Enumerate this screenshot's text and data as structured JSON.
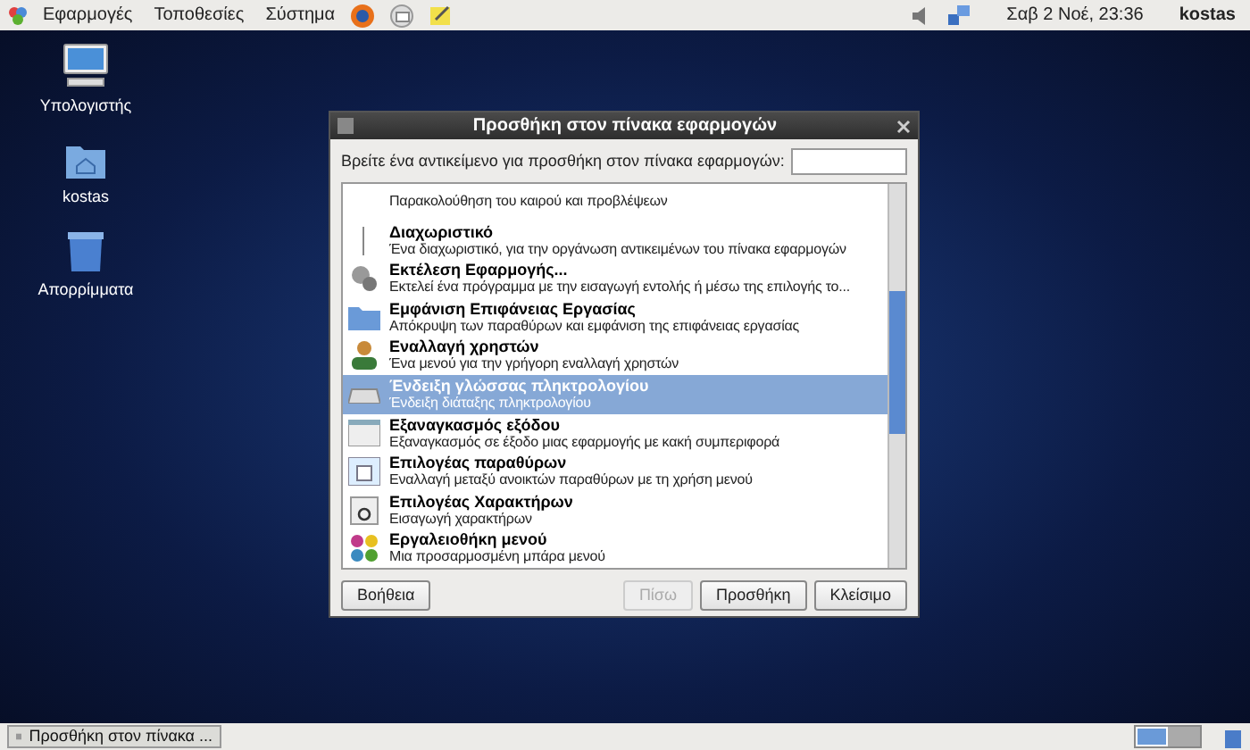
{
  "top_panel": {
    "menus": [
      {
        "label": "Εφαρμογές"
      },
      {
        "label": "Τοποθεσίες"
      },
      {
        "label": "Σύστημα"
      }
    ],
    "clock": "Σαβ  2 Νοέ, 23:36",
    "user": "kostas"
  },
  "desktop_icons": [
    {
      "label": "Υπολογιστής"
    },
    {
      "label": "kostas"
    },
    {
      "label": "Απορρίμματα"
    }
  ],
  "dialog": {
    "title": "Προσθήκη στον πίνακα εφαρμογών",
    "search_label": "Βρείτε ένα αντικείμενο για προσθήκη στον πίνακα εφαρμογών:",
    "items": [
      {
        "description": "Παρακολούθηση του καιρού και προβλέψεων",
        "selected": false
      },
      {
        "title": "Διαχωριστικό",
        "description": "Ένα διαχωριστικό, για την οργάνωση αντικειμένων του πίνακα εφαρμογών",
        "selected": false
      },
      {
        "title": "Εκτέλεση Εφαρμογής...",
        "description": "Εκτελεί ένα πρόγραμμα με την εισαγωγή εντολής ή μέσω της επιλογής το...",
        "selected": false
      },
      {
        "title": "Εμφάνιση Επιφάνειας Εργασίας",
        "description": "Απόκρυψη των παραθύρων και εμφάνιση της επιφάνειας εργασίας",
        "selected": false
      },
      {
        "title": "Εναλλαγή χρηστών",
        "description": "Ένα μενού για την γρήγορη εναλλαγή χρηστών",
        "selected": false
      },
      {
        "title": "Ένδειξη γλώσσας πληκτρολογίου",
        "description": "Ένδειξη διάταξης πληκτρολογίου",
        "selected": true
      },
      {
        "title": "Εξαναγκασμός εξόδου",
        "description": "Εξαναγκασμός σε έξοδο μιας εφαρμογής με κακή συμπεριφορά",
        "selected": false
      },
      {
        "title": "Επιλογέας παραθύρων",
        "description": "Εναλλαγή μεταξύ ανοικτών παραθύρων με τη χρήση μενού",
        "selected": false
      },
      {
        "title": "Επιλογέας Χαρακτήρων",
        "description": "Εισαγωγή χαρακτήρων",
        "selected": false
      },
      {
        "title": "Εργαλειοθήκη μενού",
        "description": "Μια προσαρμοσμένη μπάρα μενού",
        "selected": false
      }
    ],
    "buttons": [
      {
        "label": "Βοήθεια",
        "disabled": false
      },
      {
        "label": "Πίσω",
        "disabled": true
      },
      {
        "label": "Προσθήκη",
        "disabled": false
      },
      {
        "label": "Κλείσιμο",
        "disabled": false
      }
    ]
  },
  "taskbar": {
    "windows": [
      {
        "label": "Προσθήκη στον πίνακα ..."
      }
    ],
    "workspaces": [
      {
        "selected": true
      },
      {
        "selected": false
      }
    ]
  }
}
